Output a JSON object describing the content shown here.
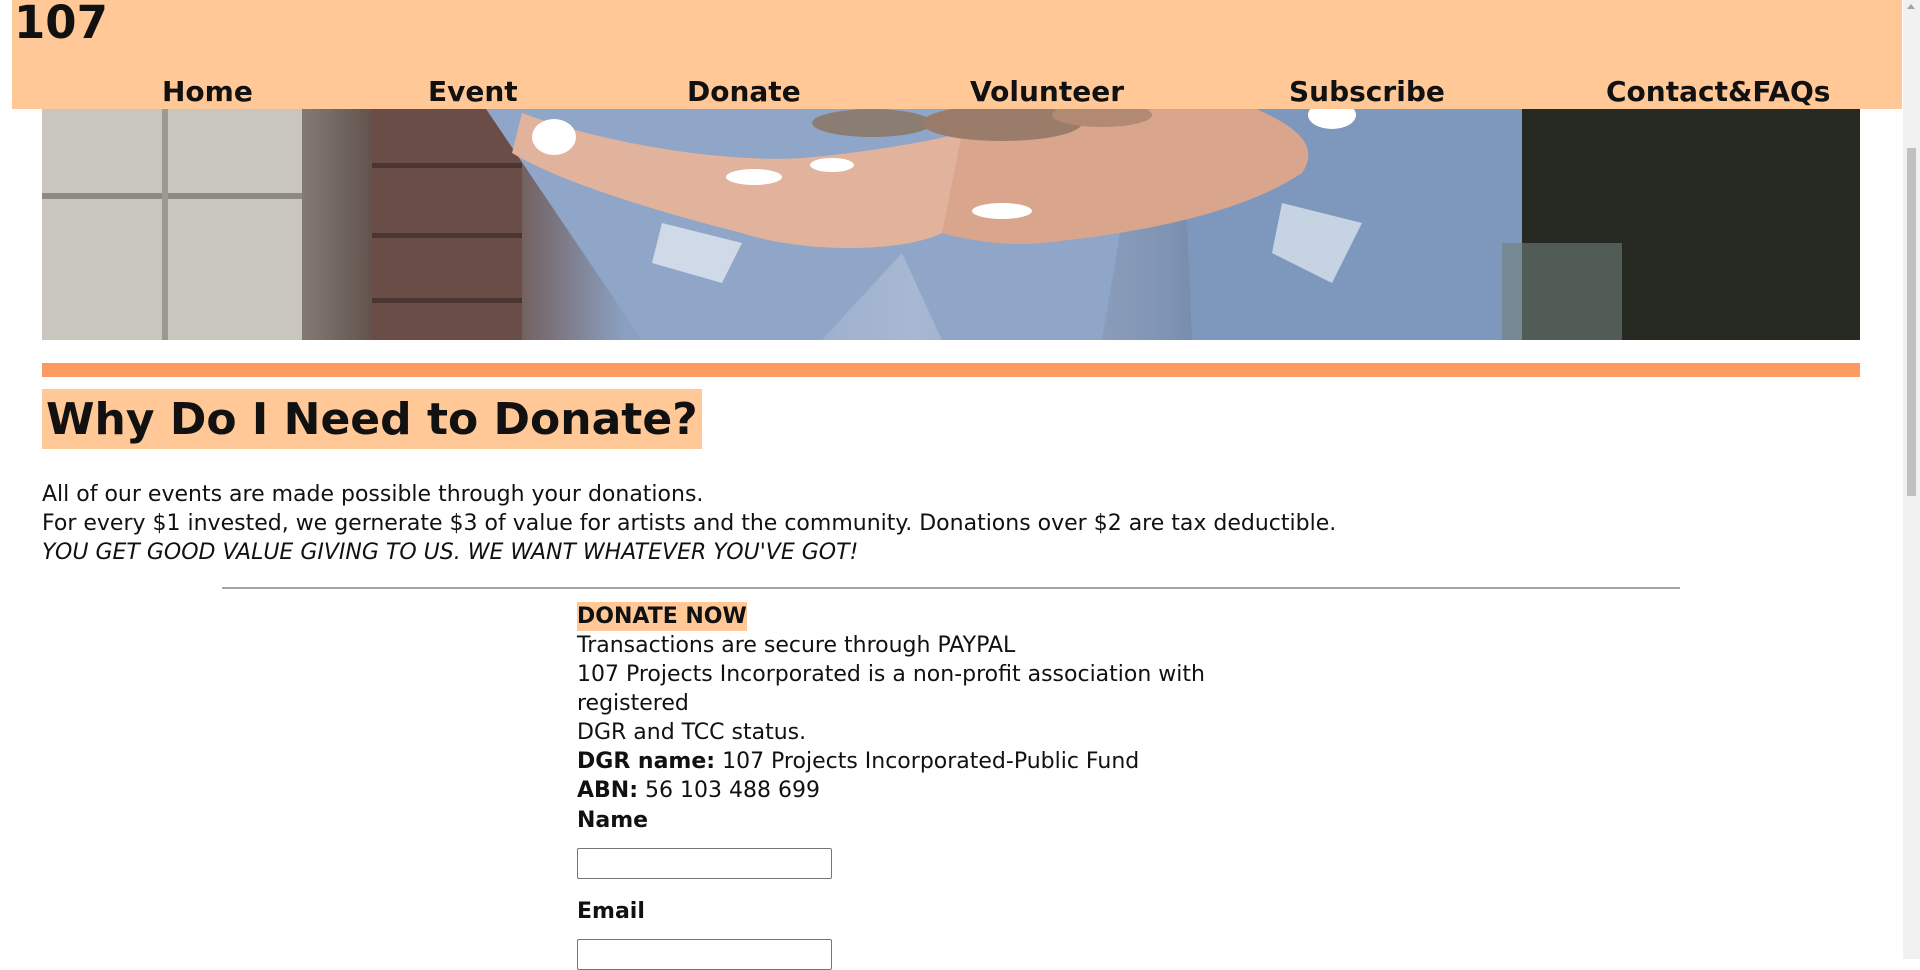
{
  "header": {
    "logo": "107",
    "nav": [
      {
        "label": "Home"
      },
      {
        "label": "Event"
      },
      {
        "label": "Donate"
      },
      {
        "label": "Volunteer"
      },
      {
        "label": "Subscribe"
      },
      {
        "label": "Contact&FAQs"
      }
    ]
  },
  "main": {
    "heading": "Why Do I Need to Donate?",
    "intro": {
      "line1": "All of our events are made possible through your donations.",
      "line2": "For every $1 invested, we gernerate $3 of value for artists and the community. Donations over $2 are tax deductible.",
      "line3": "YOU GET GOOD VALUE GIVING TO US. WE WANT WHATEVER YOU'VE GOT!"
    },
    "donate": {
      "title": "DONATE NOW",
      "secure": "Transactions are secure through PAYPAL",
      "nonprofit_1": "107 Projects Incorporated is a non-profit association with registered",
      "nonprofit_2": "DGR and TCC status.",
      "dgr_label": "DGR name:",
      "dgr_value": " 107 Projects Incorporated-Public Fund",
      "abn_label": "ABN:",
      "abn_value": " 56 103 488 699"
    },
    "form": {
      "name_label": "Name",
      "name_value": "",
      "email_label": "Email",
      "email_value": ""
    }
  },
  "colors": {
    "header_bg": "#ffc896",
    "accent_rule": "#fd9a62",
    "highlight": "#ffc896"
  }
}
